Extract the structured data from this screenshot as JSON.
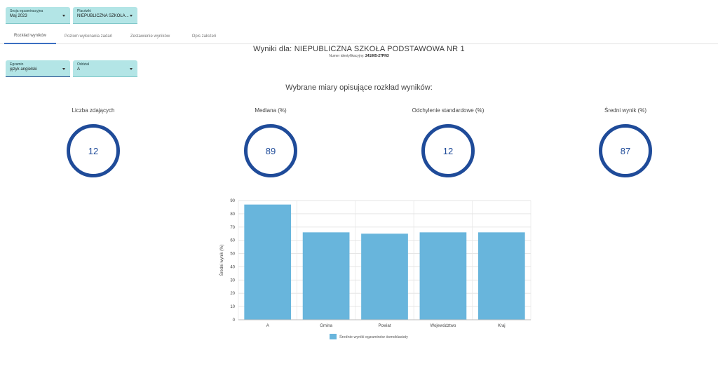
{
  "filters": {
    "session": {
      "label": "Sesja egzaminacyjna",
      "value": "Maj 2023"
    },
    "facility": {
      "label": "Placówki",
      "value": "NIEPUBLICZNA SZKOŁA..."
    },
    "exam": {
      "label": "Egzamin",
      "value": "język angielski"
    },
    "class": {
      "label": "Oddział",
      "value": "A"
    }
  },
  "tabs": [
    {
      "label": "Rozkład wyników"
    },
    {
      "label": "Poziom wykonania zadań"
    },
    {
      "label": "Zestawienie wyników"
    },
    {
      "label": "Opis założeń"
    }
  ],
  "header": {
    "title": "Wyniki dla: NIEPUBLICZNA SZKOŁA PODSTAWOWA NR 1",
    "id_label": "Numer identyfikacyjny:",
    "id_value": "241005-27PN3"
  },
  "measures_title": "Wybrane miary opisujące rozkład wyników:",
  "stats": [
    {
      "label": "Liczba zdających",
      "value": "12"
    },
    {
      "label": "Mediana (%)",
      "value": "89"
    },
    {
      "label": "Odchylenie standardowe (%)",
      "value": "12"
    },
    {
      "label": "Średni wynik (%)",
      "value": "87"
    }
  ],
  "colors": {
    "bar": "#68b5dc",
    "ring": "#1f4b99",
    "tab_active": "#3b6fc2",
    "select_bg": "#b3e5e6"
  },
  "chart_data": {
    "type": "bar",
    "categories": [
      "A",
      "Gmina",
      "Powiat",
      "Województwo",
      "Kraj"
    ],
    "series": [
      {
        "name": "Średnie wyniki egzaminów ósmoklasisty",
        "values": [
          87,
          66,
          65,
          66,
          66
        ]
      }
    ],
    "ylabel": "Średni wynik (%)",
    "xlabel": "",
    "ylim": [
      0,
      90
    ],
    "yticks": [
      0,
      10,
      20,
      30,
      40,
      50,
      60,
      70,
      80,
      90
    ],
    "grid": true,
    "legend": "bottom-center"
  }
}
